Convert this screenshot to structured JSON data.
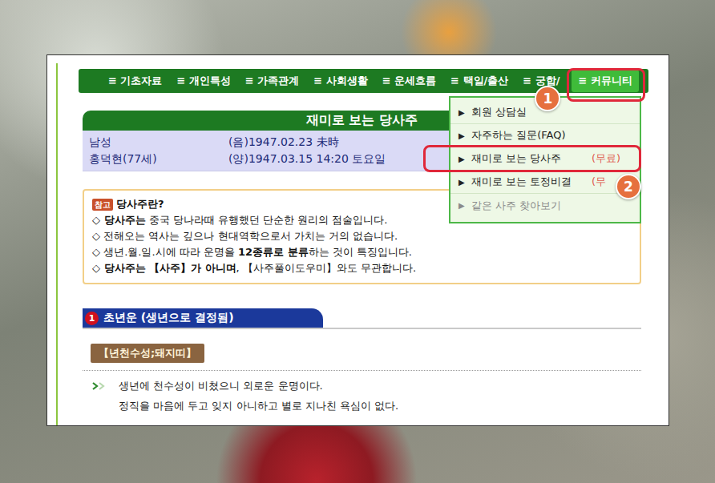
{
  "nav": {
    "items": [
      {
        "label": "≡ 기초자료",
        "selected": false,
        "annotation": ""
      },
      {
        "label": "≡ 개인특성",
        "selected": false,
        "annotation": ""
      },
      {
        "label": "≡ 가족관계",
        "selected": false,
        "annotation": ""
      },
      {
        "label": "≡ 사회생활",
        "selected": false,
        "annotation": ""
      },
      {
        "label": "≡ 운세흐름",
        "selected": false,
        "annotation": ""
      },
      {
        "label": "≡ 택일/출산",
        "selected": false,
        "annotation": ""
      },
      {
        "label": "≡ 궁합/",
        "selected": false,
        "annotation": ""
      },
      {
        "label": "≡ 커뮤니티",
        "selected": true,
        "annotation": "1"
      }
    ]
  },
  "dropdown": {
    "items": [
      {
        "arrow": "▶",
        "label": "회원 상담실",
        "price": "",
        "disabled": false,
        "annotation": ""
      },
      {
        "arrow": "▶",
        "label": "자주하는 질문(FAQ)",
        "price": "",
        "disabled": false,
        "annotation": ""
      },
      {
        "arrow": "▶",
        "label": "재미로 보는 당사주",
        "price": "(무료)",
        "disabled": false,
        "annotation": "2"
      },
      {
        "arrow": "▶",
        "label": "재미로 보는 토정비결",
        "price": "(무",
        "disabled": false,
        "annotation": ""
      },
      {
        "arrow": "▶",
        "label": "같은 사주 찾아보기",
        "price": "",
        "disabled": true,
        "annotation": ""
      }
    ]
  },
  "title": "재미로 보는 당사주",
  "profile": {
    "gender": "남성",
    "name": "홍덕현(77세)",
    "lunar": "(음)1947.02.23 未時",
    "solar": "(양)1947.03.15 14:20 토요일"
  },
  "notice": {
    "badge": "참고",
    "heading": "당사주란?",
    "lines": [
      [
        {
          "text": "◇ ",
          "bold": true
        },
        {
          "text": "당사주는",
          "bold": true
        },
        {
          "text": " 중국 당나라때 유행했던 단순한 원리의 점술입니다.",
          "bold": false
        }
      ],
      [
        {
          "text": "◇ 전해오는 역사는 깊으나 현대역학으로서 가치는 거의 없습니다.",
          "bold": false
        }
      ],
      [
        {
          "text": "◇ 생년.월.일.시에 따라 운명을 ",
          "bold": false
        },
        {
          "text": "12종류로 분류",
          "bold": true
        },
        {
          "text": "하는 것이 특징입니다.",
          "bold": false
        }
      ],
      [
        {
          "text": "◇ 당사주는 ",
          "bold": true
        },
        {
          "text": "【사주】가 아니며",
          "bold": true
        },
        {
          "text": ", 【사주풀이도우미】와도 무관합니다.",
          "bold": false
        }
      ]
    ]
  },
  "section": {
    "number": "1",
    "title": "초년운 (생년으로 결정됨)",
    "label": "【년천수성;돼지띠】",
    "paragraphs": [
      {
        "text": "생년에 천수성이 비쳤으니 외로운 운명이다.",
        "bullet": true
      },
      {
        "text": "정직을 마음에 두고 잊지 아니하고 별로 지나친 욕심이 없다.",
        "bullet": false
      }
    ]
  }
}
